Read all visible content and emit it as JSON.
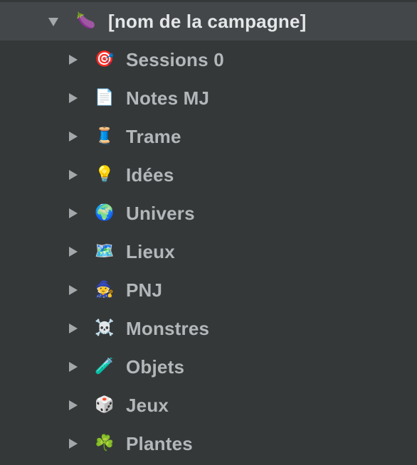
{
  "root": {
    "label": "[nom de la campagne]",
    "icon": "eggplant-icon",
    "emoji": "🍆",
    "expanded": true
  },
  "items": [
    {
      "label": "Sessions 0",
      "icon": "target-icon",
      "emoji": "🎯"
    },
    {
      "label": "Notes MJ",
      "icon": "document-icon",
      "emoji": "📄"
    },
    {
      "label": "Trame",
      "icon": "thread-spool-icon",
      "emoji": "🧵"
    },
    {
      "label": "Idées",
      "icon": "lightbulb-icon",
      "emoji": "💡"
    },
    {
      "label": "Univers",
      "icon": "globe-icon",
      "emoji": "🌍"
    },
    {
      "label": "Lieux",
      "icon": "map-icon",
      "emoji": "🗺️"
    },
    {
      "label": "PNJ",
      "icon": "mage-icon",
      "emoji": "🧙"
    },
    {
      "label": "Monstres",
      "icon": "skull-crossbones-icon",
      "emoji": "☠️"
    },
    {
      "label": "Objets",
      "icon": "test-tube-icon",
      "emoji": "🧪"
    },
    {
      "label": "Jeux",
      "icon": "dice-icon",
      "emoji": "🎲"
    },
    {
      "label": "Plantes",
      "icon": "shamrock-icon",
      "emoji": "☘️"
    }
  ],
  "colors": {
    "background": "#353839",
    "selected_row": "#43474a",
    "text": "#b4b7b9",
    "root_text": "#e4e6e7",
    "disclosure": "#a4a8ab"
  }
}
